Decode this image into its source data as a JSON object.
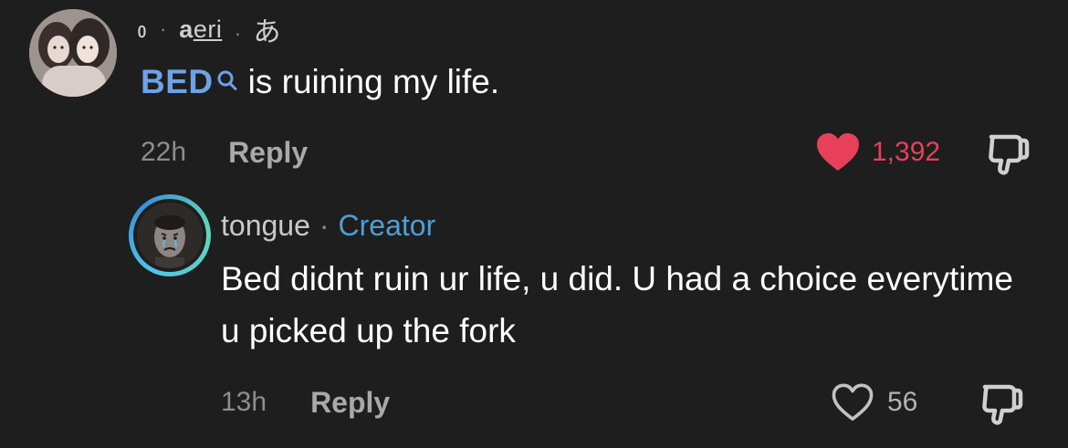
{
  "top_comment": {
    "username_prefix": "ᲂ",
    "username_dot": "·",
    "username_main": "a",
    "username_underlined": "eri",
    "username_dot2": ".",
    "username_suffix": "あ",
    "hashtag": "BED",
    "text": "is ruining my life.",
    "time": "22h",
    "reply_label": "Reply",
    "like_count": "1,392",
    "liked": true
  },
  "reply_comment": {
    "username": "tongue",
    "separator": "·",
    "badge": "Creator",
    "text": "Bed didnt ruin ur life, u did. U had a choice everytime u picked up the fork",
    "time": "13h",
    "reply_label": "Reply",
    "like_count": "56",
    "liked": false
  },
  "colors": {
    "background": "#1e1e1e",
    "hashtag": "#6ea2e8",
    "like_active": "#e8405a",
    "creator_badge": "#4e9fd6"
  },
  "icons": {
    "search": "search-icon",
    "heart_filled": "heart-filled-icon",
    "heart_outline": "heart-outline-icon",
    "dislike": "thumbs-down-icon"
  }
}
